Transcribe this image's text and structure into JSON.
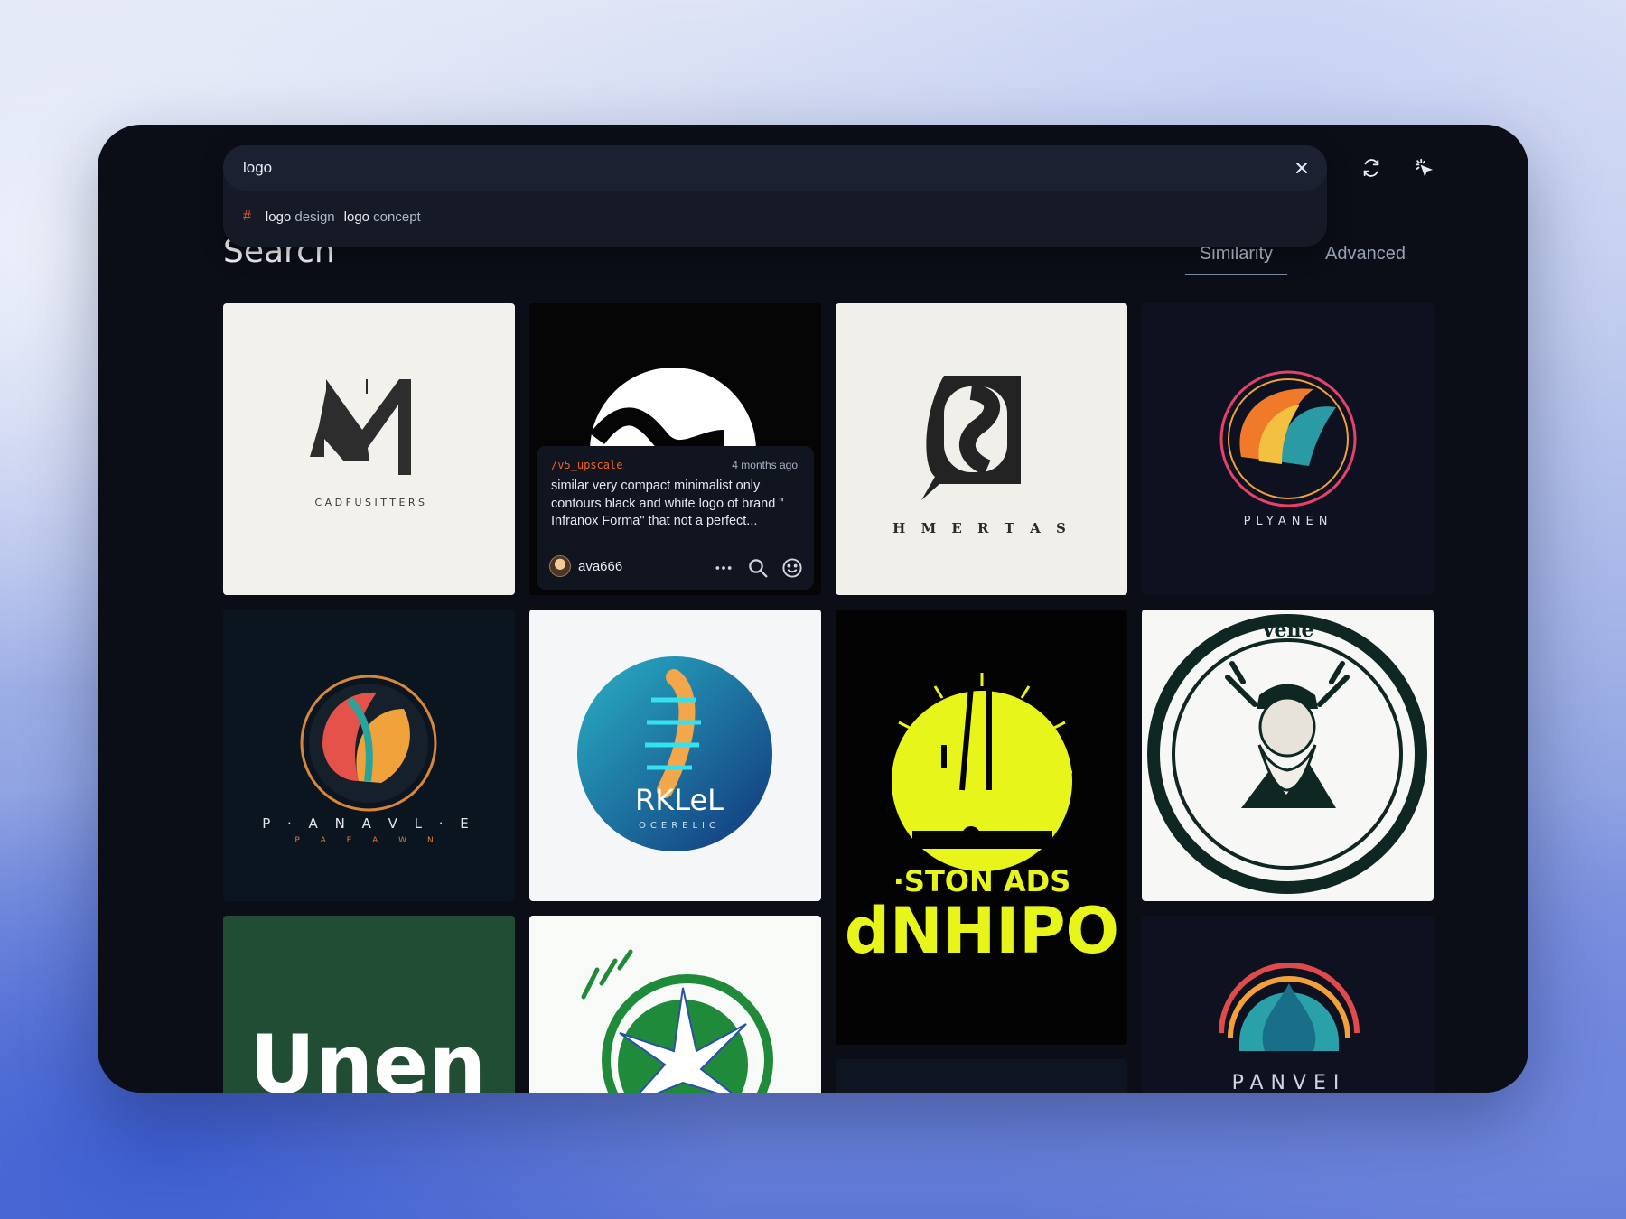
{
  "search": {
    "value": "logo",
    "placeholder": ""
  },
  "suggestions": [
    {
      "bold": "logo",
      "rest": " design"
    },
    {
      "bold": "logo",
      "rest": " concept"
    }
  ],
  "page": {
    "title": "Search"
  },
  "tabs": [
    {
      "label": "Similarity",
      "active": true
    },
    {
      "label": "Advanced",
      "active": false
    }
  ],
  "icons": {
    "hash": "hashtag-icon",
    "clear": "close-icon",
    "refresh": "refresh-icon",
    "pointer": "cursor-click-icon",
    "more": "more-icon",
    "search": "search-icon",
    "react": "smiley-icon"
  },
  "colors": {
    "accent": "#e35b21",
    "panel": "#0b0e17",
    "search_bg": "#1b2130"
  },
  "hover_card": {
    "command": "/v5_upscale",
    "time": "4 months ago",
    "prompt": "similar very compact minimalist only contours black and white logo of brand \" Infranox Forma\" that not a perfect...",
    "user": "ava666"
  },
  "tiles": [
    {
      "text": "CADFUSITTERS"
    },
    {
      "text": ""
    },
    {
      "text": "H M E R T A S"
    },
    {
      "text": "PLYANEN"
    },
    {
      "text": "P · A N A V L · E",
      "sub": "P A E A W N"
    },
    {
      "text": "RKLeL",
      "sub": "OCERELIC"
    },
    {
      "text": "·STON ADS",
      "sub": "dNHIPO"
    },
    {
      "text": "Vene"
    },
    {
      "text": "Unen"
    },
    {
      "text": ""
    },
    {
      "text": "PANVEI"
    }
  ]
}
